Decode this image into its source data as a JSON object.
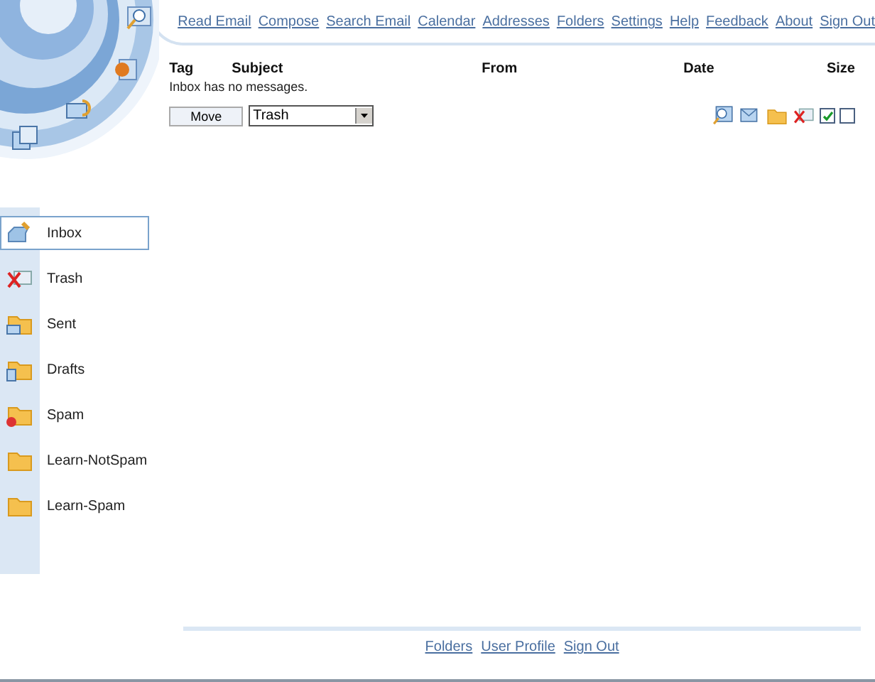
{
  "nav_links": [
    "Read Email",
    "Compose",
    "Search Email",
    "Calendar",
    "Addresses",
    "Folders",
    "Settings",
    "Help",
    "Feedback",
    "About",
    "Sign Out"
  ],
  "message_list": {
    "columns": [
      "Tag",
      "Subject",
      "From",
      "Date",
      "Size"
    ],
    "empty_message": "Inbox has no messages.",
    "move_button": "Move",
    "target_folder": "Trash",
    "checkboxes": [
      {
        "checked": true
      },
      {
        "checked": false
      }
    ]
  },
  "folders": [
    {
      "name": "Inbox",
      "kind": "inbox",
      "selected": true
    },
    {
      "name": "Trash",
      "kind": "trash",
      "selected": false
    },
    {
      "name": "Sent",
      "kind": "sent",
      "selected": false
    },
    {
      "name": "Drafts",
      "kind": "drafts",
      "selected": false
    },
    {
      "name": "Spam",
      "kind": "spam",
      "selected": false
    },
    {
      "name": "Learn-NotSpam",
      "kind": "folder",
      "selected": false
    },
    {
      "name": "Learn-Spam",
      "kind": "folder",
      "selected": false
    }
  ],
  "footer_links": [
    "Folders",
    "User Profile",
    "Sign Out"
  ]
}
